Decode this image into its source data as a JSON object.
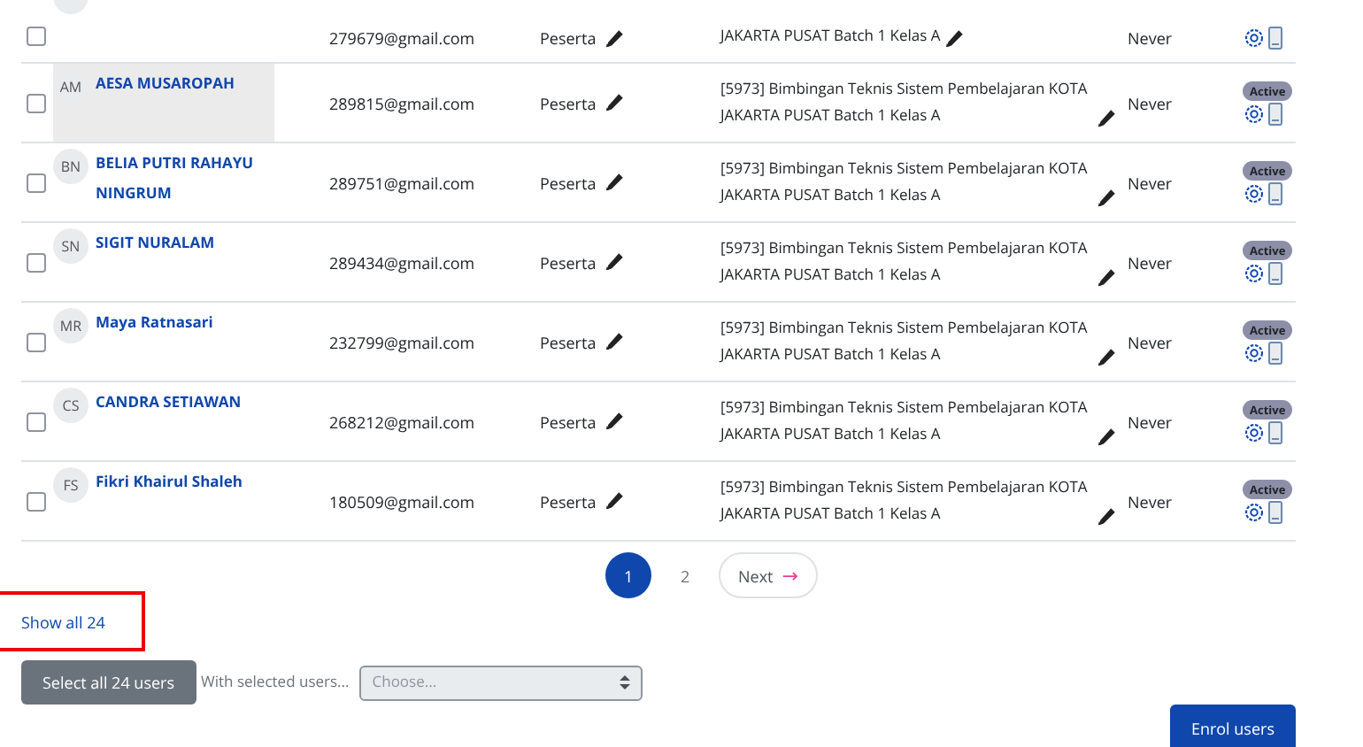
{
  "rows": [
    {
      "email": "279679@gmail.com",
      "role": "Peserta",
      "group": "JAKARTA PUSAT Batch 1 Kelas A",
      "last_access": "Never",
      "checked": false,
      "partial": true
    },
    {
      "initials": "AM",
      "name": "AESA MUSAROPAH",
      "email": "289815@gmail.com",
      "role": "Peserta",
      "group": "[5973] Bimbingan Teknis Sistem Pembelajaran KOTA JAKARTA PUSAT Batch 1 Kelas A",
      "last_access": "Never",
      "status": "Active",
      "checked": false,
      "hovered": true
    },
    {
      "initials": "BN",
      "name": "BELIA PUTRI RAHAYU NINGRUM",
      "email": "289751@gmail.com",
      "role": "Peserta",
      "group": "[5973] Bimbingan Teknis Sistem Pembelajaran KOTA JAKARTA PUSAT Batch 1 Kelas A",
      "last_access": "Never",
      "status": "Active",
      "checked": false,
      "hovered": false
    },
    {
      "initials": "SN",
      "name": "SIGIT NURALAM",
      "email": "289434@gmail.com",
      "role": "Peserta",
      "group": "[5973] Bimbingan Teknis Sistem Pembelajaran KOTA JAKARTA PUSAT Batch 1 Kelas A",
      "last_access": "Never",
      "status": "Active",
      "checked": false,
      "hovered": false
    },
    {
      "initials": "MR",
      "name": "Maya Ratnasari",
      "email": "232799@gmail.com",
      "role": "Peserta",
      "group": "[5973] Bimbingan Teknis Sistem Pembelajaran KOTA JAKARTA PUSAT Batch 1 Kelas A",
      "last_access": "Never",
      "status": "Active",
      "checked": false,
      "hovered": false
    },
    {
      "initials": "CS",
      "name": "CANDRA SETIAWAN",
      "email": "268212@gmail.com",
      "role": "Peserta",
      "group": "[5973] Bimbingan Teknis Sistem Pembelajaran KOTA JAKARTA PUSAT Batch 1 Kelas A",
      "last_access": "Never",
      "status": "Active",
      "checked": false,
      "hovered": false
    },
    {
      "initials": "FS",
      "name": "Fikri Khairul Shaleh",
      "email": "180509@gmail.com",
      "role": "Peserta",
      "group": "[5973] Bimbingan Teknis Sistem Pembelajaran KOTA JAKARTA PUSAT Batch 1 Kelas A",
      "last_access": "Never",
      "status": "Active",
      "checked": false,
      "hovered": false
    }
  ],
  "pagination": {
    "pages": [
      {
        "label": "1",
        "selected": true
      },
      {
        "label": "2",
        "selected": false
      }
    ],
    "next": "Next",
    "next_icon": "→"
  },
  "show_all": {
    "label": "Show all 24",
    "highlighted": true
  },
  "bulk": {
    "select_all": "Select all 24 users",
    "with_selected": "With selected users...",
    "placeholder": "Choose..."
  },
  "enrol_button": "Enrol users"
}
